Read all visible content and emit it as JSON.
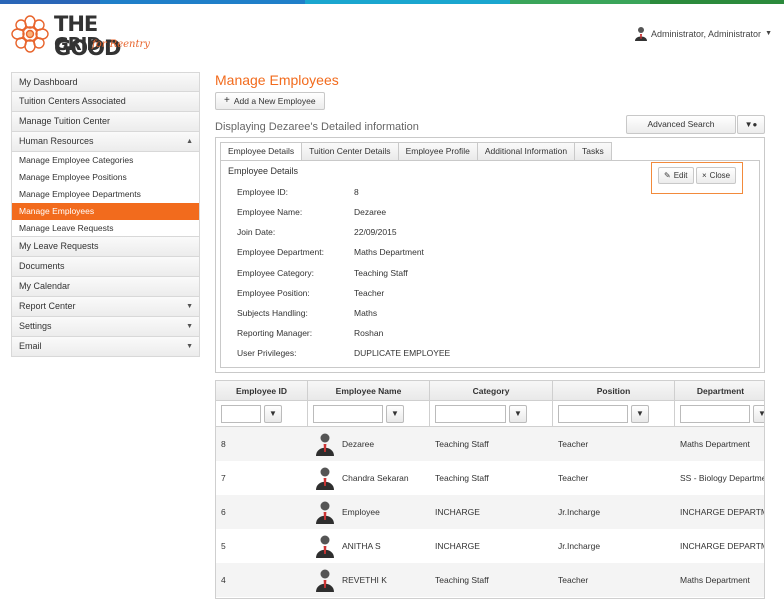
{
  "colors": {
    "accent": "#f26b1d",
    "stripe": [
      "#2563b3",
      "#1d9bd7",
      "#3aa35c",
      "#2a8a3b"
    ]
  },
  "logo": {
    "line1": "THE GOOD",
    "line2": "GRID",
    "tagline": "for Reentry"
  },
  "user": {
    "name": "Administrator, Administrator",
    "icon": "user-avatar-icon"
  },
  "sidebar": {
    "items": [
      {
        "label": "My Dashboard"
      },
      {
        "label": "Tuition Centers Associated"
      },
      {
        "label": "Manage Tuition Center"
      },
      {
        "label": "Human Resources",
        "caret": "▲"
      }
    ],
    "sub": [
      {
        "label": "Manage Employee Categories"
      },
      {
        "label": "Manage Employee Positions"
      },
      {
        "label": "Manage Employee Departments"
      },
      {
        "label": "Manage Employees",
        "active": true
      },
      {
        "label": "Manage Leave Requests"
      }
    ],
    "items2": [
      {
        "label": "My Leave Requests"
      },
      {
        "label": "Documents"
      },
      {
        "label": "My Calendar"
      },
      {
        "label": "Report Center",
        "caret": "▼"
      },
      {
        "label": "Settings",
        "caret": "▼"
      },
      {
        "label": "Email",
        "caret": "▼"
      }
    ]
  },
  "main": {
    "title": "Manage Employees",
    "add_button": "Add a New Employee",
    "subtitle": "Displaying Dezaree's Detailed information",
    "advanced_search": "Advanced Search"
  },
  "tabs": [
    "Employee Details",
    "Tuition Center Details",
    "Employee Profile",
    "Additional Information",
    "Tasks"
  ],
  "details": {
    "title": "Employee Details",
    "edit": "Edit",
    "close": "Close",
    "fields": [
      {
        "label": "Employee ID:",
        "value": "8"
      },
      {
        "label": "Employee Name:",
        "value": "Dezaree"
      },
      {
        "label": "Join Date:",
        "value": "22/09/2015"
      },
      {
        "label": "Employee Department:",
        "value": "Maths Department"
      },
      {
        "label": "Employee Category:",
        "value": "Teaching Staff"
      },
      {
        "label": "Employee Position:",
        "value": "Teacher"
      },
      {
        "label": "Subjects Handling:",
        "value": "Maths"
      },
      {
        "label": "Reporting Manager:",
        "value": "Roshan"
      },
      {
        "label": "User Privileges:",
        "value": "DUPLICATE EMPLOYEE"
      }
    ]
  },
  "grid": {
    "columns": [
      "Employee ID",
      "Employee Name",
      "Category",
      "Position",
      "Department"
    ],
    "rows": [
      {
        "id": "8",
        "name": "Dezaree",
        "category": "Teaching Staff",
        "position": "Teacher",
        "department": "Maths Department"
      },
      {
        "id": "7",
        "name": "Chandra Sekaran",
        "category": "Teaching Staff",
        "position": "Teacher",
        "department": "SS - Biology Departmen"
      },
      {
        "id": "6",
        "name": "Employee",
        "category": "INCHARGE",
        "position": "Jr.Incharge",
        "department": "INCHARGE DEPARTMEN"
      },
      {
        "id": "5",
        "name": "ANITHA S",
        "category": "INCHARGE",
        "position": "Jr.Incharge",
        "department": "INCHARGE DEPARTMEN"
      },
      {
        "id": "4",
        "name": "REVETHI K",
        "category": "Teaching Staff",
        "position": "Teacher",
        "department": "Maths Department"
      }
    ]
  }
}
